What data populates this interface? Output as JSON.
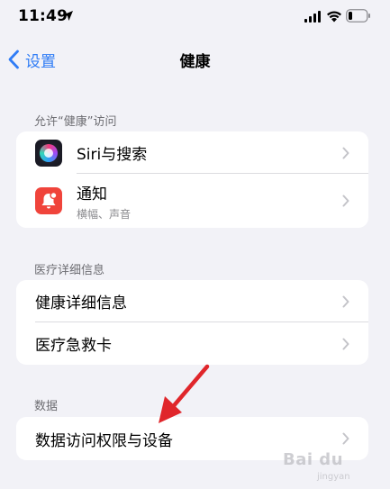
{
  "status_bar": {
    "time": "11:49"
  },
  "nav": {
    "back_label": "设置",
    "title": "健康"
  },
  "sections": {
    "allow_access": {
      "header": "允许“健康”访问",
      "items": [
        {
          "label": "Siri与搜索",
          "icon": "siri-icon"
        },
        {
          "label": "通知",
          "sublabel": "横幅、声音",
          "icon": "notification-bell-icon"
        }
      ]
    },
    "medical": {
      "header": "医疗详细信息",
      "items": [
        {
          "label": "健康详细信息"
        },
        {
          "label": "医疗急救卡"
        }
      ]
    },
    "data": {
      "header": "数据",
      "items": [
        {
          "label": "数据访问权限与设备"
        }
      ]
    }
  },
  "watermark": {
    "brand": "Bai du",
    "sub": "jingyan"
  },
  "colors": {
    "background": "#f2f2f7",
    "accent": "#2f7cf6",
    "notification_red": "#f0443b",
    "arrow_red": "#e0262b"
  }
}
